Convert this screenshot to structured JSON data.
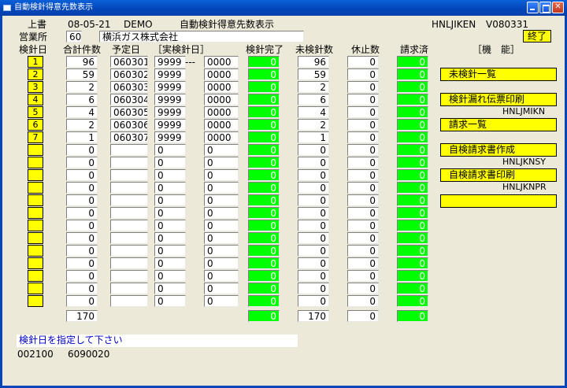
{
  "window": {
    "title": "自動検針得意先数表示",
    "controls": [
      "minimize",
      "maximize",
      "close"
    ]
  },
  "header": {
    "mode": "上書",
    "date": "08-05-21",
    "env": "DEMO",
    "screen_title": "自動検針得意先数表示",
    "program_id": "HNLJIKEN",
    "version": "V080331",
    "office_label": "営業所",
    "office_code": "60",
    "office_name": "横浜ガス株式会社",
    "end_button": "終了"
  },
  "columns": {
    "day": "検針日",
    "total": "合計件数",
    "scheduled": "予定日",
    "actual": "［実検針日］",
    "done": "検針完了",
    "not_done": "未検針数",
    "paused": "休止数",
    "billed": "請求済",
    "functions": "［機　能］"
  },
  "rows": [
    {
      "day": "1",
      "total": "96",
      "scheduled": "060301",
      "actual_a": "9999",
      "sep": "---",
      "actual_b": "0000",
      "done": "0",
      "not_done": "96",
      "paused": "0",
      "billed": "0"
    },
    {
      "day": "2",
      "total": "59",
      "scheduled": "060302",
      "actual_a": "9999",
      "sep": "",
      "actual_b": "0000",
      "done": "0",
      "not_done": "59",
      "paused": "0",
      "billed": "0"
    },
    {
      "day": "3",
      "total": "2",
      "scheduled": "060303",
      "actual_a": "9999",
      "sep": "",
      "actual_b": "0000",
      "done": "0",
      "not_done": "2",
      "paused": "0",
      "billed": "0"
    },
    {
      "day": "4",
      "total": "6",
      "scheduled": "060304",
      "actual_a": "9999",
      "sep": "",
      "actual_b": "0000",
      "done": "0",
      "not_done": "6",
      "paused": "0",
      "billed": "0"
    },
    {
      "day": "5",
      "total": "4",
      "scheduled": "060305",
      "actual_a": "9999",
      "sep": "",
      "actual_b": "0000",
      "done": "0",
      "not_done": "4",
      "paused": "0",
      "billed": "0"
    },
    {
      "day": "6",
      "total": "2",
      "scheduled": "060306",
      "actual_a": "9999",
      "sep": "",
      "actual_b": "0000",
      "done": "0",
      "not_done": "2",
      "paused": "0",
      "billed": "0"
    },
    {
      "day": "7",
      "total": "1",
      "scheduled": "060307",
      "actual_a": "9999",
      "sep": "",
      "actual_b": "0000",
      "done": "0",
      "not_done": "1",
      "paused": "0",
      "billed": "0"
    },
    {
      "day": "",
      "total": "0",
      "scheduled": "",
      "actual_a": "0",
      "sep": "",
      "actual_b": "0",
      "done": "0",
      "not_done": "0",
      "paused": "0",
      "billed": "0"
    },
    {
      "day": "",
      "total": "0",
      "scheduled": "",
      "actual_a": "0",
      "sep": "",
      "actual_b": "0",
      "done": "0",
      "not_done": "0",
      "paused": "0",
      "billed": "0"
    },
    {
      "day": "",
      "total": "0",
      "scheduled": "",
      "actual_a": "0",
      "sep": "",
      "actual_b": "0",
      "done": "0",
      "not_done": "0",
      "paused": "0",
      "billed": "0"
    },
    {
      "day": "",
      "total": "0",
      "scheduled": "",
      "actual_a": "0",
      "sep": "",
      "actual_b": "0",
      "done": "0",
      "not_done": "0",
      "paused": "0",
      "billed": "0"
    },
    {
      "day": "",
      "total": "0",
      "scheduled": "",
      "actual_a": "0",
      "sep": "",
      "actual_b": "0",
      "done": "0",
      "not_done": "0",
      "paused": "0",
      "billed": "0"
    },
    {
      "day": "",
      "total": "0",
      "scheduled": "",
      "actual_a": "0",
      "sep": "",
      "actual_b": "0",
      "done": "0",
      "not_done": "0",
      "paused": "0",
      "billed": "0"
    },
    {
      "day": "",
      "total": "0",
      "scheduled": "",
      "actual_a": "0",
      "sep": "",
      "actual_b": "0",
      "done": "0",
      "not_done": "0",
      "paused": "0",
      "billed": "0"
    },
    {
      "day": "",
      "total": "0",
      "scheduled": "",
      "actual_a": "0",
      "sep": "",
      "actual_b": "0",
      "done": "0",
      "not_done": "0",
      "paused": "0",
      "billed": "0"
    },
    {
      "day": "",
      "total": "0",
      "scheduled": "",
      "actual_a": "0",
      "sep": "",
      "actual_b": "0",
      "done": "0",
      "not_done": "0",
      "paused": "0",
      "billed": "0"
    },
    {
      "day": "",
      "total": "0",
      "scheduled": "",
      "actual_a": "0",
      "sep": "",
      "actual_b": "0",
      "done": "0",
      "not_done": "0",
      "paused": "0",
      "billed": "0"
    },
    {
      "day": "",
      "total": "0",
      "scheduled": "",
      "actual_a": "0",
      "sep": "",
      "actual_b": "0",
      "done": "0",
      "not_done": "0",
      "paused": "0",
      "billed": "0"
    },
    {
      "day": "",
      "total": "0",
      "scheduled": "",
      "actual_a": "0",
      "sep": "",
      "actual_b": "0",
      "done": "0",
      "not_done": "0",
      "paused": "0",
      "billed": "0"
    },
    {
      "day": "",
      "total": "0",
      "scheduled": "",
      "actual_a": "0",
      "sep": "",
      "actual_b": "0",
      "done": "0",
      "not_done": "0",
      "paused": "0",
      "billed": "0"
    }
  ],
  "totals": {
    "total": "170",
    "done": "0",
    "not_done": "170",
    "paused": "0",
    "billed": "0"
  },
  "functions": [
    {
      "label": "未検針一覧",
      "code": ""
    },
    {
      "label": "検針漏れ伝票印刷",
      "code": "HNLJMIKN"
    },
    {
      "label": "請求一覧",
      "code": ""
    },
    {
      "label": "自検請求書作成",
      "code": "HNLJKNSY"
    },
    {
      "label": "自検請求書印刷",
      "code": "HNLJKNPR"
    },
    {
      "label": "",
      "code": ""
    }
  ],
  "status": {
    "message": "検針日を指定して下さい",
    "code1": "002100",
    "code2": "6090020"
  },
  "colors": {
    "titlebar": "#0446b8",
    "background": "#ece9d8",
    "highlight_yellow": "#ffff00",
    "complete_green": "#00ff00",
    "message_blue": "#0000cc"
  }
}
